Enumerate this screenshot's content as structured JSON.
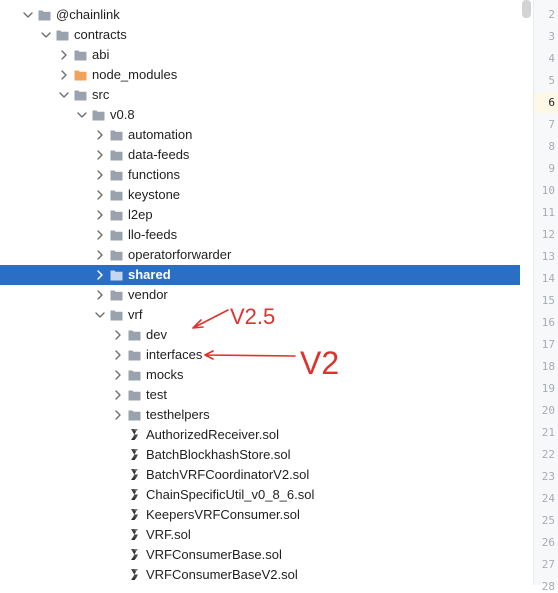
{
  "tree": [
    {
      "label": "@chainlink",
      "depth": 1,
      "type": "folder",
      "expanded": true
    },
    {
      "label": "contracts",
      "depth": 2,
      "type": "folder",
      "expanded": true
    },
    {
      "label": "abi",
      "depth": 3,
      "type": "folder",
      "expanded": false
    },
    {
      "label": "node_modules",
      "depth": 3,
      "type": "folder-excluded",
      "expanded": false
    },
    {
      "label": "src",
      "depth": 3,
      "type": "folder",
      "expanded": true
    },
    {
      "label": "v0.8",
      "depth": 4,
      "type": "folder",
      "expanded": true
    },
    {
      "label": "automation",
      "depth": 5,
      "type": "folder",
      "expanded": false
    },
    {
      "label": "data-feeds",
      "depth": 5,
      "type": "folder",
      "expanded": false
    },
    {
      "label": "functions",
      "depth": 5,
      "type": "folder",
      "expanded": false
    },
    {
      "label": "keystone",
      "depth": 5,
      "type": "folder",
      "expanded": false
    },
    {
      "label": "l2ep",
      "depth": 5,
      "type": "folder",
      "expanded": false
    },
    {
      "label": "llo-feeds",
      "depth": 5,
      "type": "folder",
      "expanded": false
    },
    {
      "label": "operatorforwarder",
      "depth": 5,
      "type": "folder",
      "expanded": false
    },
    {
      "label": "shared",
      "depth": 5,
      "type": "folder",
      "expanded": false,
      "selected": true
    },
    {
      "label": "vendor",
      "depth": 5,
      "type": "folder",
      "expanded": false
    },
    {
      "label": "vrf",
      "depth": 5,
      "type": "folder",
      "expanded": true
    },
    {
      "label": "dev",
      "depth": 6,
      "type": "folder",
      "expanded": false
    },
    {
      "label": "interfaces",
      "depth": 6,
      "type": "folder",
      "expanded": false
    },
    {
      "label": "mocks",
      "depth": 6,
      "type": "folder",
      "expanded": false
    },
    {
      "label": "test",
      "depth": 6,
      "type": "folder",
      "expanded": false
    },
    {
      "label": "testhelpers",
      "depth": 6,
      "type": "folder",
      "expanded": false
    },
    {
      "label": "AuthorizedReceiver.sol",
      "depth": 6,
      "type": "sol-file"
    },
    {
      "label": "BatchBlockhashStore.sol",
      "depth": 6,
      "type": "sol-file"
    },
    {
      "label": "BatchVRFCoordinatorV2.sol",
      "depth": 6,
      "type": "sol-file"
    },
    {
      "label": "ChainSpecificUtil_v0_8_6.sol",
      "depth": 6,
      "type": "sol-file"
    },
    {
      "label": "KeepersVRFConsumer.sol",
      "depth": 6,
      "type": "sol-file"
    },
    {
      "label": "VRF.sol",
      "depth": 6,
      "type": "sol-file"
    },
    {
      "label": "VRFConsumerBase.sol",
      "depth": 6,
      "type": "sol-file"
    },
    {
      "label": "VRFConsumerBaseV2.sol",
      "depth": 6,
      "type": "sol-file"
    }
  ],
  "gutter": {
    "line_numbers": [
      "2",
      "3",
      "4",
      "5",
      "6",
      "7",
      "8",
      "9",
      "10",
      "11",
      "12",
      "13",
      "14",
      "15",
      "16",
      "17",
      "18",
      "19",
      "20",
      "21",
      "22",
      "23",
      "24",
      "25",
      "26",
      "27",
      "28"
    ],
    "active_line": "6"
  },
  "annotations": [
    {
      "text": "V2.5",
      "points_to": "dev"
    },
    {
      "text": "V2",
      "points_to": "interfaces"
    }
  ],
  "colors": {
    "selection": "#2a6fc4",
    "folder": "#9aa3ad",
    "folder_excluded": "#f0a15a",
    "annotation": "#e0322c"
  },
  "icons": {
    "expanded": "chevron-down-icon",
    "collapsed": "chevron-right-icon",
    "folder": "folder-icon",
    "sol_file": "solidity-file-icon"
  }
}
